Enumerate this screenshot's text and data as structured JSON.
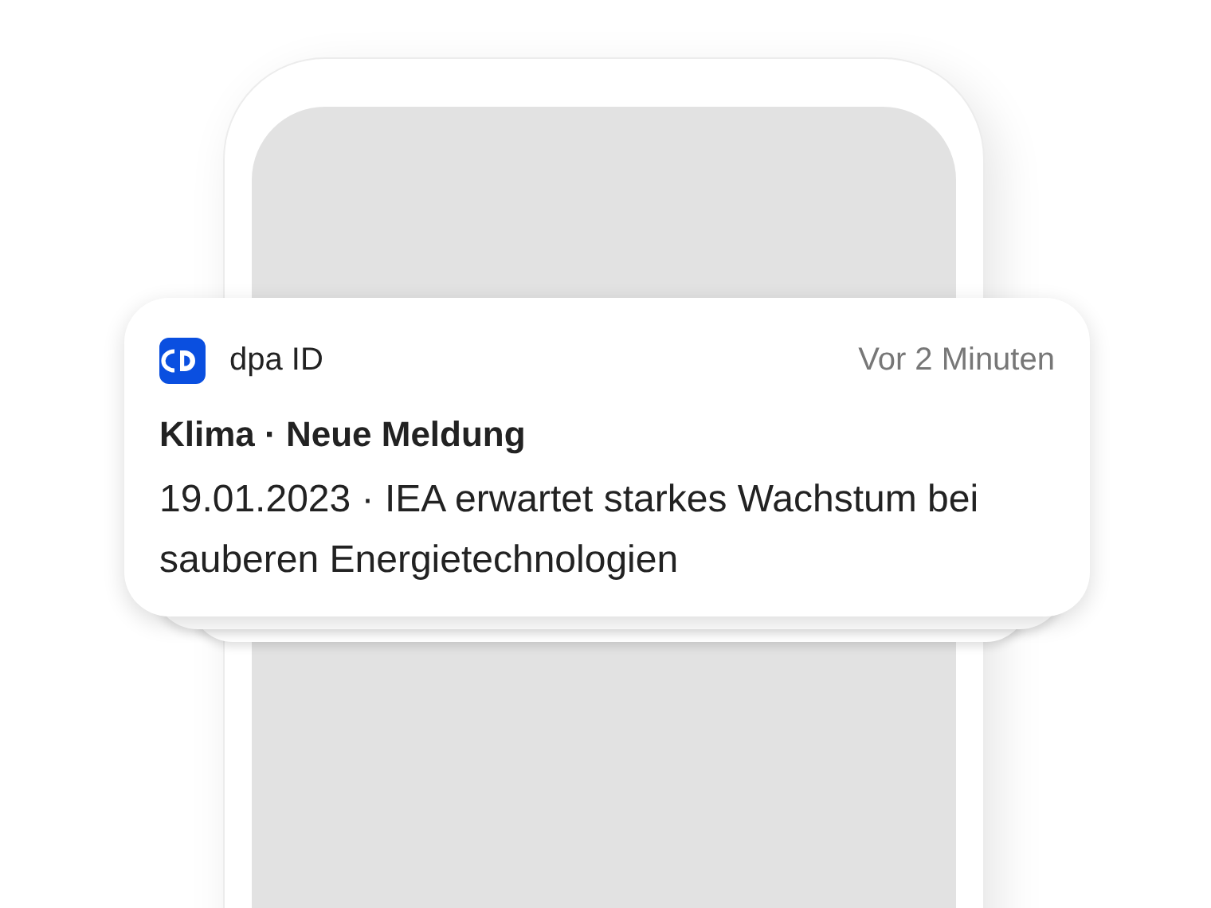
{
  "notification": {
    "app_name": "dpa ID",
    "time": "Vor 2 Minuten",
    "title": "Klima · Neue Meldung",
    "body": "19.01.2023 · IEA erwartet starkes Wachstum bei sauberen Energietechnologien"
  }
}
